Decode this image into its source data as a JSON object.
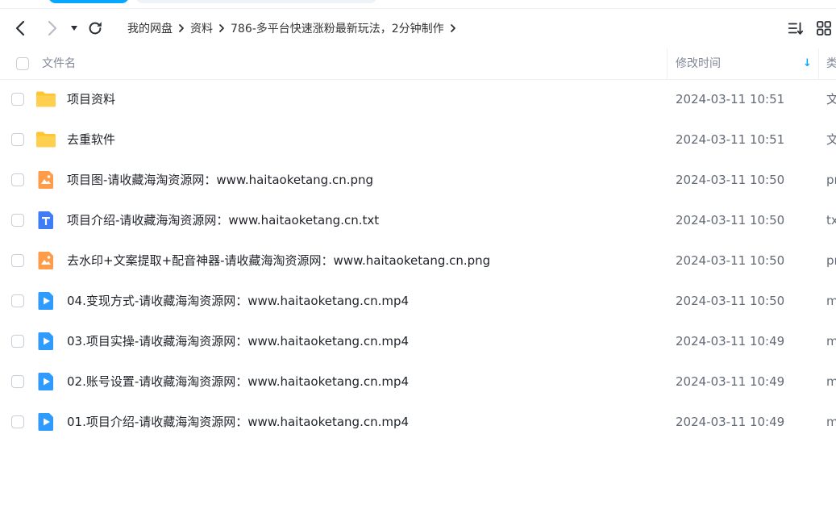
{
  "nav": {
    "back_icon": "chevron-left-icon",
    "forward_icon": "chevron-right-icon",
    "history_icon": "caret-down-icon",
    "refresh_icon": "refresh-icon"
  },
  "breadcrumb": [
    {
      "label": "我的网盘"
    },
    {
      "label": "资料"
    },
    {
      "label": "786-多平台快速涨粉最新玩法，2分钟制作"
    }
  ],
  "toolbar": {
    "sort_icon": "sort-icon",
    "view_icon": "grid-view-icon"
  },
  "columns": {
    "name": "文件名",
    "mtime": "修改时间",
    "type": "类",
    "sort_indicator": "↓"
  },
  "colors": {
    "folder": "#ffc42e",
    "image": "#ff9c4a",
    "text": "#3f7cf7",
    "video": "#2f9bff",
    "accent": "#06a7ff"
  },
  "files": [
    {
      "name": "项目资料",
      "mtime": "2024-03-11 10:51",
      "type": "文",
      "icon": "folder-icon"
    },
    {
      "name": "去重软件",
      "mtime": "2024-03-11 10:51",
      "type": "文",
      "icon": "folder-icon"
    },
    {
      "name": "项目图-请收藏海淘资源网：www.haitaoketang.cn.png",
      "mtime": "2024-03-11 10:50",
      "type": "pı",
      "icon": "image-file-icon"
    },
    {
      "name": "项目介绍-请收藏海淘资源网：www.haitaoketang.cn.txt",
      "mtime": "2024-03-11 10:50",
      "type": "tx",
      "icon": "text-file-icon"
    },
    {
      "name": "去水印+文案提取+配音神器-请收藏海淘资源网：www.haitaoketang.cn.png",
      "mtime": "2024-03-11 10:50",
      "type": "pı",
      "icon": "image-file-icon"
    },
    {
      "name": "04.变现方式-请收藏海淘资源网：www.haitaoketang.cn.mp4",
      "mtime": "2024-03-11 10:50",
      "type": "m",
      "icon": "video-file-icon"
    },
    {
      "name": "03.项目实操-请收藏海淘资源网：www.haitaoketang.cn.mp4",
      "mtime": "2024-03-11 10:49",
      "type": "m",
      "icon": "video-file-icon"
    },
    {
      "name": "02.账号设置-请收藏海淘资源网：www.haitaoketang.cn.mp4",
      "mtime": "2024-03-11 10:49",
      "type": "m",
      "icon": "video-file-icon"
    },
    {
      "name": "01.项目介绍-请收藏海淘资源网：www.haitaoketang.cn.mp4",
      "mtime": "2024-03-11 10:49",
      "type": "m",
      "icon": "video-file-icon"
    }
  ]
}
